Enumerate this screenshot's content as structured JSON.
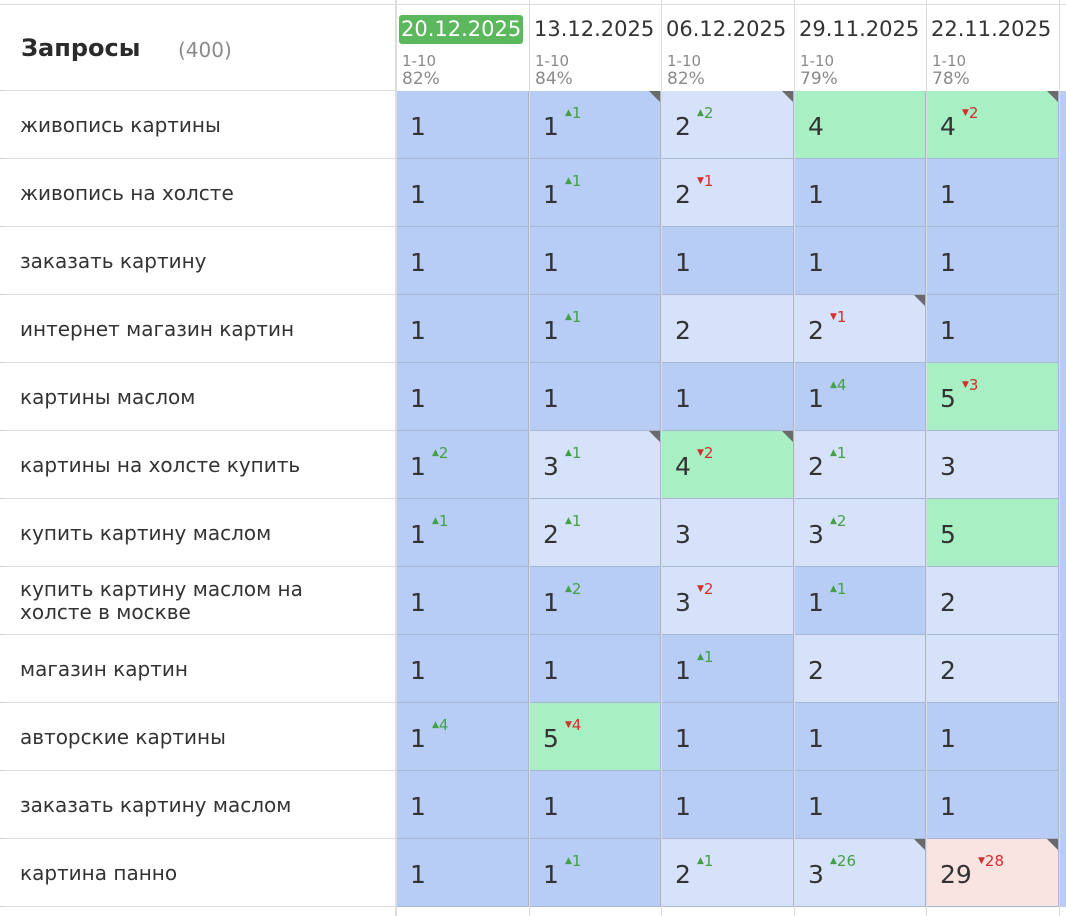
{
  "header": {
    "title": "Запросы",
    "count": "(400)",
    "dates": [
      {
        "date": "20.12.2025",
        "range": "1-10",
        "pct": "82%",
        "current": true
      },
      {
        "date": "13.12.2025",
        "range": "1-10",
        "pct": "84%",
        "current": false
      },
      {
        "date": "06.12.2025",
        "range": "1-10",
        "pct": "82%",
        "current": false
      },
      {
        "date": "29.11.2025",
        "range": "1-10",
        "pct": "79%",
        "current": false
      },
      {
        "date": "22.11.2025",
        "range": "1-10",
        "pct": "78%",
        "current": false
      }
    ]
  },
  "colors": {
    "blue": "#b7cdf6",
    "pale": "#d6e2f9",
    "green": "#a8efc3",
    "pink": "#f9e4e1",
    "current_date": "#5cb85c",
    "delta_up": "#43a047",
    "delta_down": "#d32f2f"
  },
  "rows": [
    {
      "query": "живопись картины",
      "cells": [
        {
          "v": "1",
          "c": "blue"
        },
        {
          "v": "1",
          "c": "blue",
          "dir": "up",
          "d": "1",
          "corner": true
        },
        {
          "v": "2",
          "c": "pale",
          "dir": "up",
          "d": "2",
          "corner": true
        },
        {
          "v": "4",
          "c": "green"
        },
        {
          "v": "4",
          "c": "green",
          "dir": "down",
          "d": "2",
          "corner": true
        }
      ]
    },
    {
      "query": "живопись на холсте",
      "cells": [
        {
          "v": "1",
          "c": "blue"
        },
        {
          "v": "1",
          "c": "blue",
          "dir": "up",
          "d": "1"
        },
        {
          "v": "2",
          "c": "pale",
          "dir": "down",
          "d": "1"
        },
        {
          "v": "1",
          "c": "blue"
        },
        {
          "v": "1",
          "c": "blue"
        }
      ]
    },
    {
      "query": "заказать картину",
      "cells": [
        {
          "v": "1",
          "c": "blue"
        },
        {
          "v": "1",
          "c": "blue"
        },
        {
          "v": "1",
          "c": "blue"
        },
        {
          "v": "1",
          "c": "blue"
        },
        {
          "v": "1",
          "c": "blue"
        }
      ]
    },
    {
      "query": "интернет магазин картин",
      "cells": [
        {
          "v": "1",
          "c": "blue"
        },
        {
          "v": "1",
          "c": "blue",
          "dir": "up",
          "d": "1"
        },
        {
          "v": "2",
          "c": "pale"
        },
        {
          "v": "2",
          "c": "pale",
          "dir": "down",
          "d": "1",
          "corner": true
        },
        {
          "v": "1",
          "c": "blue"
        }
      ]
    },
    {
      "query": "картины маслом",
      "cells": [
        {
          "v": "1",
          "c": "blue"
        },
        {
          "v": "1",
          "c": "blue"
        },
        {
          "v": "1",
          "c": "blue"
        },
        {
          "v": "1",
          "c": "blue",
          "dir": "up",
          "d": "4"
        },
        {
          "v": "5",
          "c": "green",
          "dir": "down",
          "d": "3"
        }
      ]
    },
    {
      "query": "картины на холсте купить",
      "cells": [
        {
          "v": "1",
          "c": "blue",
          "dir": "up",
          "d": "2"
        },
        {
          "v": "3",
          "c": "pale",
          "dir": "up",
          "d": "1",
          "corner": true
        },
        {
          "v": "4",
          "c": "green",
          "dir": "down",
          "d": "2",
          "corner": true
        },
        {
          "v": "2",
          "c": "pale",
          "dir": "up",
          "d": "1"
        },
        {
          "v": "3",
          "c": "pale"
        }
      ]
    },
    {
      "query": "купить картину маслом",
      "cells": [
        {
          "v": "1",
          "c": "blue",
          "dir": "up",
          "d": "1"
        },
        {
          "v": "2",
          "c": "pale",
          "dir": "up",
          "d": "1"
        },
        {
          "v": "3",
          "c": "pale"
        },
        {
          "v": "3",
          "c": "pale",
          "dir": "up",
          "d": "2"
        },
        {
          "v": "5",
          "c": "green"
        }
      ]
    },
    {
      "query": "купить картину маслом на холсте в москве",
      "cells": [
        {
          "v": "1",
          "c": "blue"
        },
        {
          "v": "1",
          "c": "blue",
          "dir": "up",
          "d": "2"
        },
        {
          "v": "3",
          "c": "pale",
          "dir": "down",
          "d": "2"
        },
        {
          "v": "1",
          "c": "blue",
          "dir": "up",
          "d": "1"
        },
        {
          "v": "2",
          "c": "pale"
        }
      ]
    },
    {
      "query": "магазин картин",
      "cells": [
        {
          "v": "1",
          "c": "blue"
        },
        {
          "v": "1",
          "c": "blue"
        },
        {
          "v": "1",
          "c": "blue",
          "dir": "up",
          "d": "1"
        },
        {
          "v": "2",
          "c": "pale"
        },
        {
          "v": "2",
          "c": "pale"
        }
      ]
    },
    {
      "query": "авторские картины",
      "cells": [
        {
          "v": "1",
          "c": "blue",
          "dir": "up",
          "d": "4"
        },
        {
          "v": "5",
          "c": "green",
          "dir": "down",
          "d": "4"
        },
        {
          "v": "1",
          "c": "blue"
        },
        {
          "v": "1",
          "c": "blue"
        },
        {
          "v": "1",
          "c": "blue"
        }
      ]
    },
    {
      "query": "заказать картину маслом",
      "cells": [
        {
          "v": "1",
          "c": "blue"
        },
        {
          "v": "1",
          "c": "blue"
        },
        {
          "v": "1",
          "c": "blue"
        },
        {
          "v": "1",
          "c": "blue"
        },
        {
          "v": "1",
          "c": "blue"
        }
      ]
    },
    {
      "query": "картина панно",
      "cells": [
        {
          "v": "1",
          "c": "blue"
        },
        {
          "v": "1",
          "c": "blue",
          "dir": "up",
          "d": "1"
        },
        {
          "v": "2",
          "c": "pale",
          "dir": "up",
          "d": "1"
        },
        {
          "v": "3",
          "c": "pale",
          "dir": "up",
          "d": "26",
          "corner": true
        },
        {
          "v": "29",
          "c": "pink",
          "dir": "down",
          "d": "28",
          "corner": true
        }
      ]
    }
  ]
}
